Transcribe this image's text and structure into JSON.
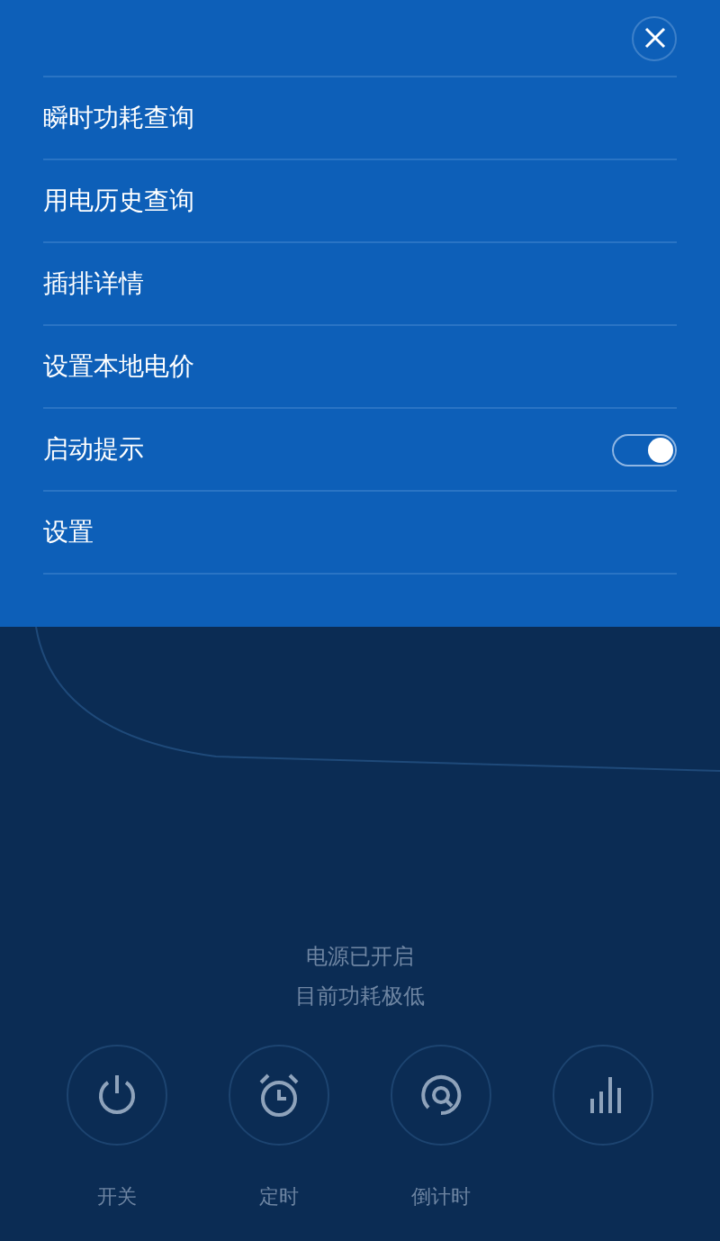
{
  "menu": {
    "items": [
      {
        "kind": "link",
        "label": "瞬时功耗查询"
      },
      {
        "kind": "link",
        "label": "用电历史查询"
      },
      {
        "kind": "link",
        "label": "插排详情"
      },
      {
        "kind": "link",
        "label": "设置本地电价"
      },
      {
        "kind": "toggle",
        "label": "启动提示",
        "on": true
      },
      {
        "kind": "link",
        "label": "设置"
      }
    ]
  },
  "status": [
    "电源已开启",
    "目前功耗极低"
  ],
  "controls": [
    {
      "kind": "power",
      "label": "开关"
    },
    {
      "kind": "alarm",
      "label": "定时"
    },
    {
      "kind": "countdown",
      "label": "倒计时"
    },
    {
      "kind": "stats"
    }
  ]
}
